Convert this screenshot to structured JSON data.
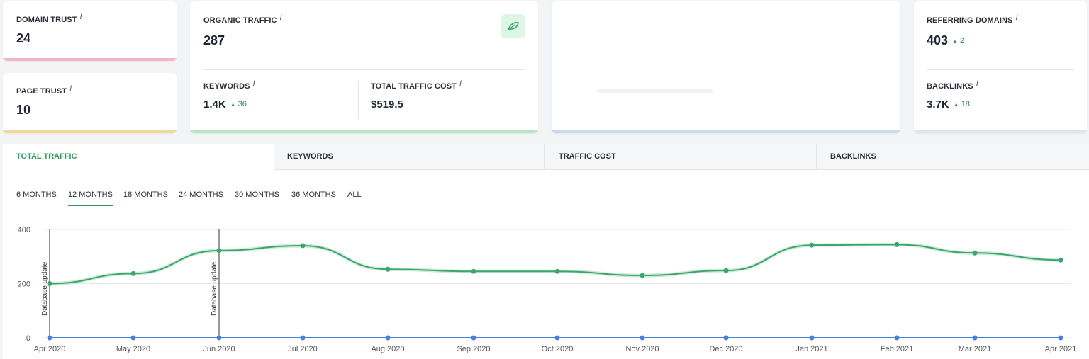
{
  "metrics": {
    "domain_trust": {
      "label": "DOMAIN TRUST",
      "info": "i",
      "value": "24",
      "accent": "#f5b3c3"
    },
    "page_trust": {
      "label": "PAGE TRUST",
      "info": "i",
      "value": "10",
      "accent": "#f1d99a"
    },
    "organic_traffic": {
      "label": "ORGANIC TRAFFIC",
      "info": "i",
      "value": "287",
      "accent": "#b9e6c8"
    },
    "keywords": {
      "label": "KEYWORDS",
      "info": "i",
      "value": "1.4K",
      "delta": "36"
    },
    "total_traffic_cost": {
      "label": "TOTAL TRAFFIC COST",
      "info": "i",
      "value": "$519.5"
    },
    "blank_card": {
      "accent": "#c7d9f3"
    },
    "referring_domains": {
      "label": "REFERRING DOMAINS",
      "info": "i",
      "value": "403",
      "delta": "2"
    },
    "backlinks": {
      "label": "BACKLINKS",
      "info": "i",
      "value": "3.7K",
      "delta": "18",
      "accent": "#e2e4e8"
    }
  },
  "icons": {
    "organic": "leaf-icon",
    "delta": "triangle-up-icon"
  },
  "tabs": [
    {
      "label": "TOTAL TRAFFIC",
      "active": true
    },
    {
      "label": "KEYWORDS",
      "active": false
    },
    {
      "label": "TRAFFIC COST",
      "active": false
    },
    {
      "label": "BACKLINKS",
      "active": false
    }
  ],
  "ranges": [
    {
      "label": "6 MONTHS",
      "active": false
    },
    {
      "label": "12 MONTHS",
      "active": true
    },
    {
      "label": "18 MONTHS",
      "active": false
    },
    {
      "label": "24 MONTHS",
      "active": false
    },
    {
      "label": "30 MONTHS",
      "active": false
    },
    {
      "label": "36 MONTHS",
      "active": false
    },
    {
      "label": "ALL",
      "active": false
    }
  ],
  "colors": {
    "green": "#3aa66c",
    "blue": "#4a7fe0",
    "active_tab": "#2e9e63"
  },
  "chart_data": {
    "type": "line",
    "categories": [
      "Apr 2020",
      "May 2020",
      "Jun 2020",
      "Jul 2020",
      "Aug 2020",
      "Sep 2020",
      "Oct 2020",
      "Nov 2020",
      "Dec 2020",
      "Jan 2021",
      "Feb 2021",
      "Mar 2021",
      "Apr 2021"
    ],
    "series": [
      {
        "color": "#3aa66c",
        "values": [
          200,
          237,
          322,
          340,
          253,
          245,
          245,
          230,
          248,
          342,
          344,
          313,
          287
        ]
      },
      {
        "color": "#4a7fe0",
        "values": [
          0,
          0,
          0,
          0,
          0,
          0,
          0,
          0,
          0,
          0,
          0,
          0,
          0
        ]
      }
    ],
    "ylim": [
      0,
      400
    ],
    "yticks": [
      0,
      200,
      400
    ],
    "grid": true,
    "annotations": [
      {
        "category": "Apr 2020",
        "text": "Database update"
      },
      {
        "category": "Jun 2020",
        "text": "Database update"
      }
    ]
  }
}
